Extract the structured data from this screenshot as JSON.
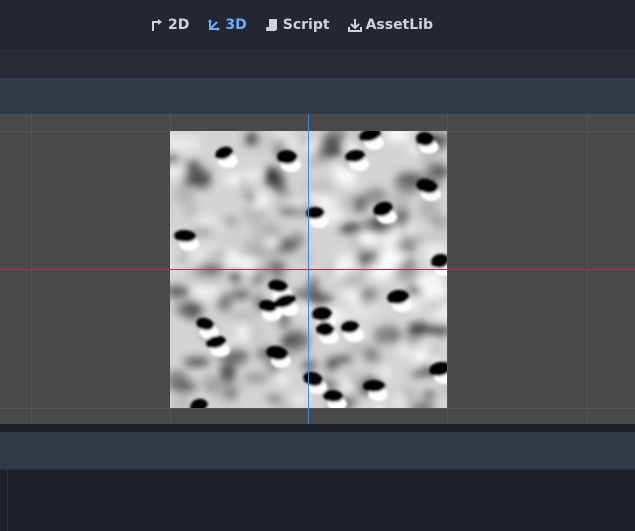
{
  "workspace_tabs": [
    {
      "label": "2D",
      "icon": "2d-icon",
      "active": false
    },
    {
      "label": "3D",
      "icon": "3d-icon",
      "active": true
    },
    {
      "label": "Script",
      "icon": "script-icon",
      "active": false
    },
    {
      "label": "AssetLib",
      "icon": "assetlib-icon",
      "active": false
    }
  ],
  "colors": {
    "active_tab": "#6ab0ff",
    "inactive_tab": "#d0d4da",
    "axis_x": "#c0284f",
    "axis_y": "#3d8ae0",
    "viewport_bg": "#494949"
  },
  "viewport": {
    "content": "noise-texture"
  }
}
